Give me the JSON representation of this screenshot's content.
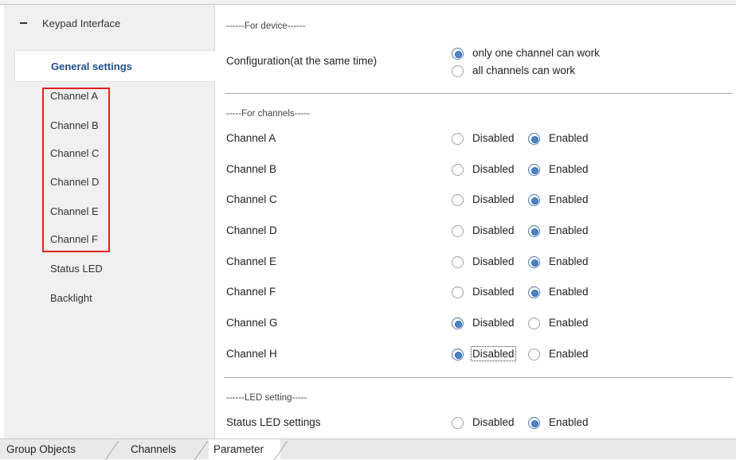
{
  "sidebar": {
    "root": {
      "label": "Keypad Interface"
    },
    "items": [
      {
        "label": "General settings",
        "selected": true
      },
      {
        "label": "Channel A"
      },
      {
        "label": "Channel B"
      },
      {
        "label": "Channel C"
      },
      {
        "label": "Channel D"
      },
      {
        "label": "Channel E"
      },
      {
        "label": "Channel F"
      },
      {
        "label": "Status LED"
      },
      {
        "label": "Backlight"
      }
    ],
    "highlight_color": "#e02020"
  },
  "main": {
    "device_section": "------For device------",
    "configuration": {
      "label": "Configuration(at the same time)",
      "options": [
        "only one channel can work",
        "all channels can work"
      ],
      "selected": 0
    },
    "channels_section": "-----For channels-----",
    "channels": [
      {
        "label": "Channel A",
        "disabled": "Disabled",
        "enabled": "Enabled",
        "selected": "Enabled"
      },
      {
        "label": "Channel B",
        "disabled": "Disabled",
        "enabled": "Enabled",
        "selected": "Enabled"
      },
      {
        "label": "Channel C",
        "disabled": "Disabled",
        "enabled": "Enabled",
        "selected": "Enabled"
      },
      {
        "label": "Channel D",
        "disabled": "Disabled",
        "enabled": "Enabled",
        "selected": "Enabled"
      },
      {
        "label": "Channel E",
        "disabled": "Disabled",
        "enabled": "Enabled",
        "selected": "Enabled"
      },
      {
        "label": "Channel F",
        "disabled": "Disabled",
        "enabled": "Enabled",
        "selected": "Enabled"
      },
      {
        "label": "Channel G",
        "disabled": "Disabled",
        "enabled": "Enabled",
        "selected": "Disabled"
      },
      {
        "label": "Channel H",
        "disabled": "Disabled",
        "enabled": "Enabled",
        "selected": "Disabled"
      }
    ],
    "led_section": "------LED setting-----",
    "status_led": {
      "label": "Status LED settings",
      "disabled": "Disabled",
      "enabled": "Enabled",
      "selected": "Enabled"
    }
  },
  "tabs": [
    {
      "label": "Group Objects"
    },
    {
      "label": "Channels"
    },
    {
      "label": "Parameter",
      "active": true
    }
  ],
  "colors": {
    "accent": "#1f4f8a",
    "radio_fill": "#4c86c6"
  }
}
